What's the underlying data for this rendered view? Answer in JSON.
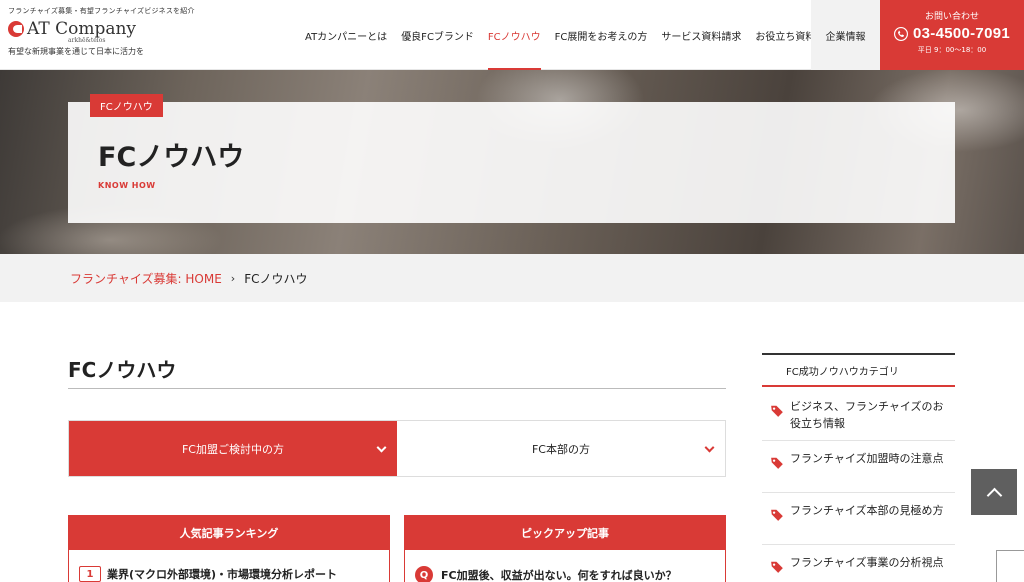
{
  "header": {
    "tagline_top": "フランチャイズ募集・有望フランチャイズビジネスを紹介",
    "logo_name": "AT Company",
    "logo_sub": "arkhē&telos",
    "tagline_bottom": "有望な新規事業を通じて日本に活力を",
    "nav": [
      {
        "label": "ATカンパニーとは"
      },
      {
        "label": "優良FCブランド"
      },
      {
        "label": "FCノウハウ"
      },
      {
        "label": "FC展開をお考えの方"
      },
      {
        "label": "サービス資料請求"
      },
      {
        "label": "お役立ち資料"
      }
    ],
    "corporate": "企業情報",
    "contact": {
      "label": "お問い合わせ",
      "phone": "03-4500-7091",
      "hours": "平日 9：00〜18：00"
    }
  },
  "hero": {
    "tag": "FCノウハウ",
    "title": "FCノウハウ",
    "subtitle": "KNOW HOW"
  },
  "breadcrumb": {
    "home": "フランチャイズ募集: HOME",
    "current": "FCノウハウ"
  },
  "main": {
    "title": "FCノウハウ",
    "tabs": [
      {
        "label": "FC加盟ご検討中の方",
        "active": true
      },
      {
        "label": "FC本部の方",
        "active": false
      }
    ],
    "ranking": {
      "heading": "人気記事ランキング",
      "first_rank": "1",
      "first_item": "業界(マクロ外部環境)・市場環境分析レポート"
    },
    "pickup": {
      "heading": "ピックアップ記事",
      "icon_letter": "Q",
      "first_item": "FC加盟後、収益が出ない。何をすれば良いか？"
    }
  },
  "sidebar": {
    "heading": "FC成功ノウハウカテゴリ",
    "items": [
      {
        "label": "ビジネス、フランチャイズのお役立ち情報"
      },
      {
        "label": "フランチャイズ加盟時の注意点"
      },
      {
        "label": "フランチャイズ本部の見極め方"
      },
      {
        "label": "フランチャイズ事業の分析視点"
      }
    ]
  },
  "colors": {
    "accent": "#d93a36",
    "dark_button": "#5f5f5f",
    "breadcrumb_bg": "#f2f2f2"
  },
  "icons": [
    "logo-mark-icon",
    "phone-icon",
    "chevron-down-icon",
    "chevron-right-icon",
    "tag-icon",
    "chevron-up-icon"
  ]
}
